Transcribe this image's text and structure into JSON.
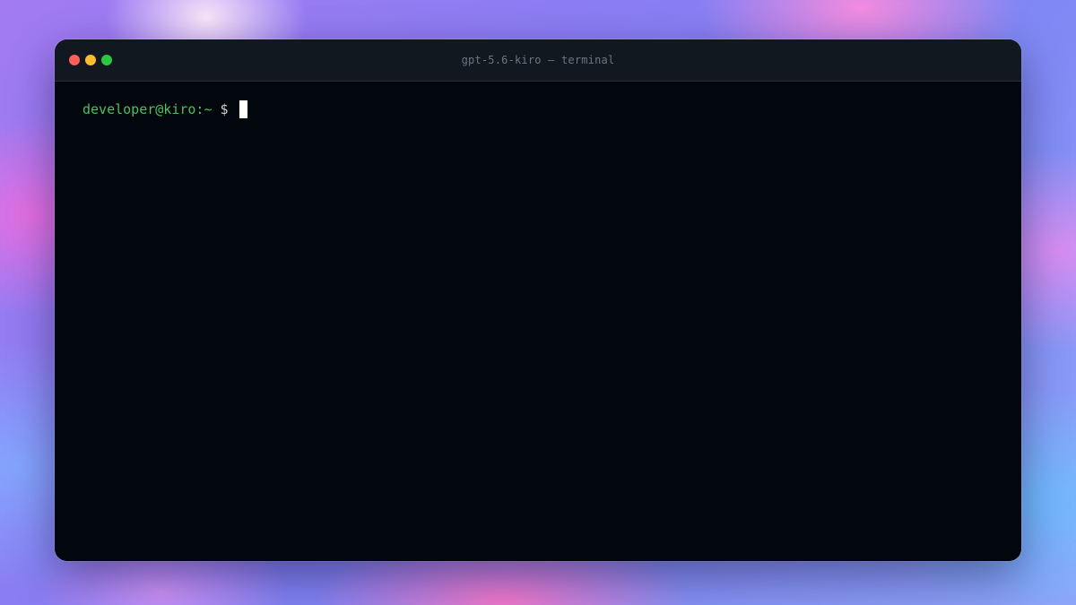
{
  "window": {
    "title": "gpt-5.6-kiro — terminal"
  },
  "terminal": {
    "prompt_user": "developer@kiro:~",
    "prompt_symbol": "$",
    "input_value": ""
  },
  "colors": {
    "close": "#fe5f57",
    "minimize": "#febc2e",
    "maximize": "#28c840",
    "prompt": "#4fbf5b",
    "terminal_background": "#02060d"
  },
  "icons": {
    "close": "close-dot-icon",
    "minimize": "minimize-dot-icon",
    "maximize": "maximize-dot-icon"
  }
}
